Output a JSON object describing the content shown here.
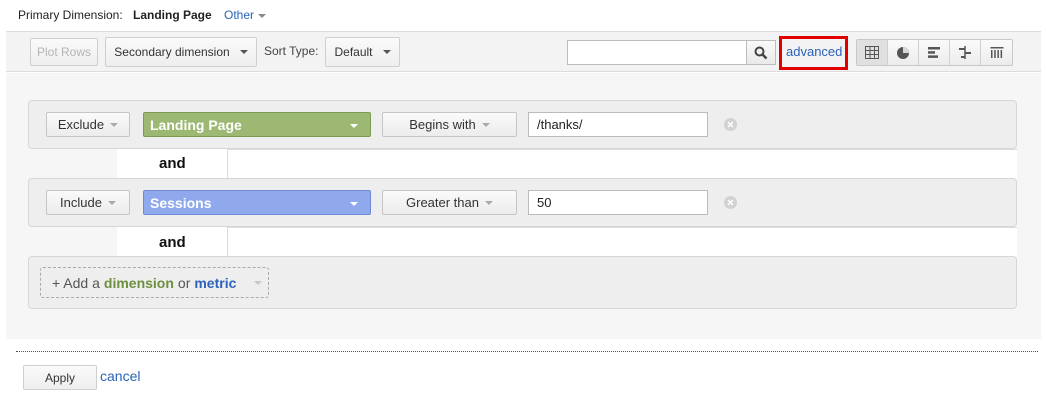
{
  "primary": {
    "label": "Primary Dimension:",
    "value": "Landing Page",
    "other": "Other"
  },
  "toolbar": {
    "plot_rows": "Plot Rows",
    "secondary_dimension": "Secondary dimension",
    "sort_type_label": "Sort Type:",
    "sort_type_value": "Default",
    "search_value": "",
    "advanced": "advanced",
    "views": [
      "table-icon",
      "pie-icon",
      "bar-icon",
      "comparison-icon",
      "pivot-icon"
    ]
  },
  "filters": {
    "conditions": [
      {
        "mode": "Exclude",
        "field": "Landing Page",
        "field_kind": "dimension",
        "operator": "Begins with",
        "value": "/thanks/"
      },
      {
        "mode": "Include",
        "field": "Sessions",
        "field_kind": "metric",
        "operator": "Greater than",
        "value": "50"
      }
    ],
    "and_label": "and",
    "add": {
      "prefix": "+ Add a",
      "dimension": "dimension",
      "or": "or",
      "metric": "metric"
    }
  },
  "footer": {
    "apply": "Apply",
    "cancel": "cancel"
  },
  "colors": {
    "dimension": "#9cb872",
    "metric": "#8fa9ec",
    "link": "#2a63b8",
    "highlight": "#e00000"
  }
}
